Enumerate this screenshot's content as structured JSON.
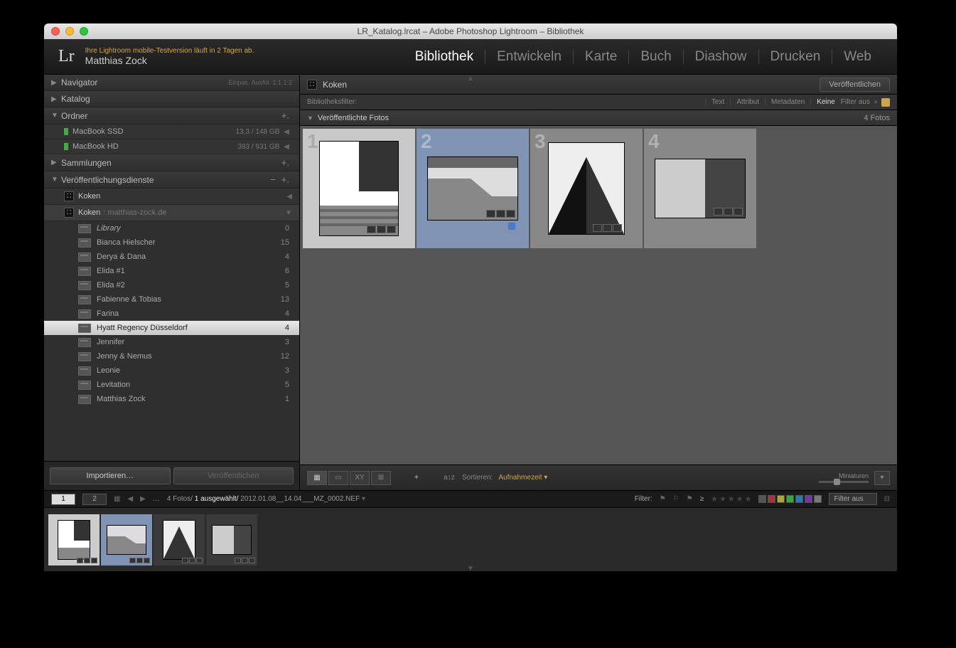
{
  "window_title": "LR_Katalog.lrcat – Adobe Photoshop Lightroom – Bibliothek",
  "identity": {
    "trial_notice": "Ihre Lightroom mobile-Testversion läuft in 2 Tagen ab.",
    "username": "Matthias Zock",
    "logo": "Lr"
  },
  "modules": [
    "Bibliothek",
    "Entwickeln",
    "Karte",
    "Buch",
    "Diashow",
    "Drucken",
    "Web"
  ],
  "active_module": "Bibliothek",
  "left": {
    "navigator": {
      "label": "Navigator",
      "extras": "Einpas.   Ausfül.   1:1   1:2"
    },
    "katalog": "Katalog",
    "ordner": "Ordner",
    "disks": [
      {
        "name": "MacBook SSD",
        "size": "13,3 / 148 GB"
      },
      {
        "name": "MacBook HD",
        "size": "393 / 931 GB"
      }
    ],
    "sammlungen": "Sammlungen",
    "publish": "Veröffentlichungsdienste",
    "services": [
      {
        "name": "Koken",
        "sub": "",
        "arrow": "◀"
      },
      {
        "name": "Koken",
        "sub": ": matthias-zock.de",
        "arrow": "▼",
        "selected": true
      }
    ],
    "folders": [
      {
        "name": "Library",
        "count": "0",
        "italic": true
      },
      {
        "name": "Bianca Hielscher",
        "count": "15"
      },
      {
        "name": "Derya & Dana",
        "count": "4"
      },
      {
        "name": "Elida #1",
        "count": "6"
      },
      {
        "name": "Elida #2",
        "count": "5"
      },
      {
        "name": "Fabienne & Tobias",
        "count": "13"
      },
      {
        "name": "Farina",
        "count": "4"
      },
      {
        "name": "Hyatt Regency Düsseldorf",
        "count": "4",
        "selected": true
      },
      {
        "name": "Jennifer",
        "count": "3"
      },
      {
        "name": "Jenny & Nemus",
        "count": "12"
      },
      {
        "name": "Leonie",
        "count": "3"
      },
      {
        "name": "Levitation",
        "count": "5"
      },
      {
        "name": "Matthias Zock",
        "count": "1"
      }
    ],
    "import_btn": "Importieren…",
    "publish_btn": "Veröffentlichen"
  },
  "center": {
    "service": "Koken",
    "publish_action": "Veröffentlichen",
    "filter_label": "Bibliotheksfilter:",
    "filter_tabs": [
      "Text",
      "Attribut",
      "Metadaten",
      "Keine"
    ],
    "filter_selected": "Keine",
    "filter_off": "Filter aus",
    "section": "Veröffentlichte Fotos",
    "count": "4 Fotos"
  },
  "toolbar": {
    "sort_label": "Sortieren:",
    "sort_value": "Aufnahmezeit",
    "mini_label": "Miniaturen"
  },
  "status": {
    "view1": "1",
    "view2": "2",
    "dots": "…",
    "info_count": "4 Fotos/",
    "info_sel": "1 ausgewählt/",
    "info_file": "2012.01.08__14.04___MZ_0002.NEF",
    "filter_label": "Filter:",
    "ge": "≥",
    "filter_dd": "Filter aus"
  },
  "swatches": [
    "#555",
    "#a33",
    "#aa3",
    "#3a3",
    "#37a",
    "#73a",
    "#777"
  ]
}
